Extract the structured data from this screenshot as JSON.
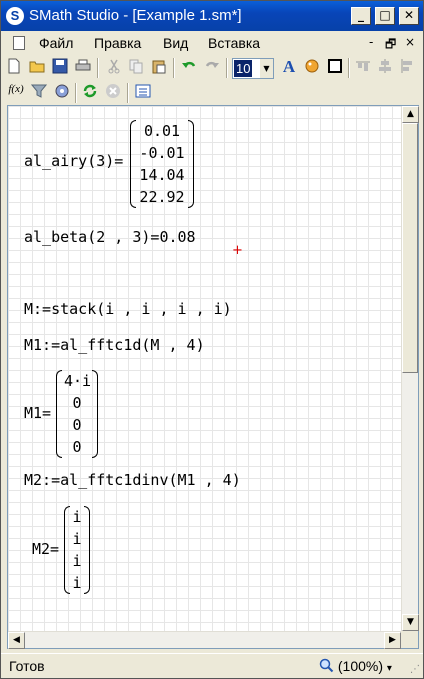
{
  "window": {
    "title": "SMath Studio - [Example 1.sm*]",
    "app_icon": "S"
  },
  "title_buttons": {
    "minimize": "_",
    "maximize": "□",
    "close": "✕"
  },
  "menu": {
    "items": [
      "Файл",
      "Правка",
      "Вид",
      "Вставка"
    ],
    "mdi_minimize": "-",
    "mdi_restore": "🗗",
    "mdi_close": "×"
  },
  "toolbar": {
    "font_size": "10"
  },
  "toolbar2": {
    "fx_label": "f(x)"
  },
  "worksheet": {
    "airy_lhs": "al_airy(3)=",
    "airy_values": [
      "0.01",
      "-0.01",
      "14.04",
      "22.92"
    ],
    "beta_expr": "al_beta(2 , 3)=0.08",
    "m_def": "M:=stack(i , i , i , i)",
    "m1_def": "M1:=al_fftc1d(M , 4)",
    "m1_lhs": "M1=",
    "m1_values": [
      "4·i",
      "0",
      "0",
      "0"
    ],
    "m2_def": "M2:=al_fftc1dinv(M1 , 4)",
    "m2_lhs": "M2=",
    "m2_values": [
      "i",
      "i",
      "i",
      "i"
    ],
    "cursor_mark": "+"
  },
  "statusbar": {
    "status": "Готов",
    "zoom": "(100%)",
    "zoom_arrow": "▾"
  }
}
